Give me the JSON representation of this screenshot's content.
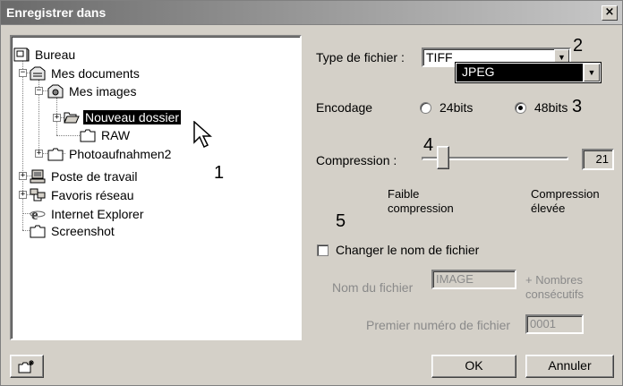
{
  "window": {
    "title": "Enregistrer dans",
    "close_glyph": "×"
  },
  "tree": {
    "items": [
      {
        "label": "Bureau",
        "icon": "desktop-icon"
      },
      {
        "label": "Mes documents",
        "icon": "documents-folder-icon"
      },
      {
        "label": "Mes images",
        "icon": "pictures-folder-icon"
      },
      {
        "label": "Nouveau dossier",
        "icon": "open-folder-icon",
        "selected": true
      },
      {
        "label": "RAW",
        "icon": "folder-icon"
      },
      {
        "label": "Photoaufnahmen2",
        "icon": "folder-icon"
      },
      {
        "label": "Poste de travail",
        "icon": "computer-icon"
      },
      {
        "label": "Favoris réseau",
        "icon": "network-icon"
      },
      {
        "label": "Internet Explorer",
        "icon": "internet-explorer-icon"
      },
      {
        "label": "Screenshot",
        "icon": "folder-icon"
      }
    ],
    "expand_plus": "+",
    "expand_minus": "−"
  },
  "callouts": {
    "c1": "1",
    "c2": "2",
    "c3": "3",
    "c4": "4",
    "c5": "5"
  },
  "filetype": {
    "label": "Type de fichier :",
    "value": "TIFF",
    "dropdown_option": "JPEG",
    "arrow": "▼"
  },
  "encoding": {
    "label": "Encodage",
    "opt24": "24bits",
    "opt48": "48bits",
    "selected": "48bits"
  },
  "compression": {
    "label": "Compression :",
    "value": "21",
    "slider_fraction": 0.1,
    "low_label_1": "Faible",
    "low_label_2": "compression",
    "high_label_1": "Compression",
    "high_label_2": "élevée"
  },
  "rename": {
    "checkbox_label": "Changer le nom de fichier",
    "checked": false,
    "filename_label": "Nom du fichier",
    "filename_value": "IMAGE",
    "suffix_1": "+ Nombres",
    "suffix_2": "consécutifs",
    "first_number_label": "Premier numéro de fichier",
    "first_number_value": "0001"
  },
  "buttons": {
    "ok": "OK",
    "cancel": "Annuler",
    "new_folder_icon": "new-folder-icon"
  }
}
